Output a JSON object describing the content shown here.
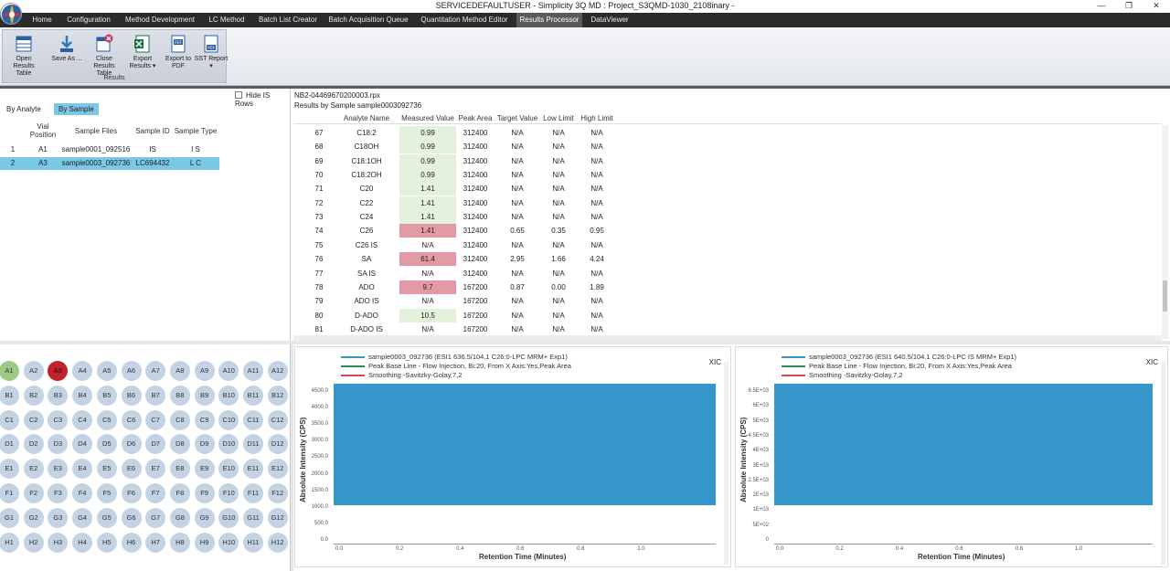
{
  "window": {
    "title": "SERVICEDEFAULTUSER - Simplicity 3Q MD : Project_S3QMD-1030_2108inary -",
    "minimize": "—",
    "restore": "❐",
    "close": "✕"
  },
  "menu": {
    "tabs": [
      "Home",
      "Configuration",
      "Method Development",
      "LC Method",
      "Batch List Creator",
      "Batch Acquisition Queue",
      "Quantitation Method Editor",
      "Results Processor",
      "DataViewer"
    ],
    "active_tab": "Results Processor"
  },
  "ribbon": {
    "group_label": "Results",
    "buttons": [
      {
        "label": "Open Results Table",
        "icon": "open-table-icon"
      },
      {
        "label": "Save As ...",
        "icon": "save-as-icon"
      },
      {
        "label": "Close Results Table",
        "icon": "close-table-icon"
      },
      {
        "label": "Export Results ▾",
        "icon": "excel-icon"
      },
      {
        "label": "Export to PDF",
        "icon": "pdf-icon"
      },
      {
        "label": "SST Report ▾",
        "icon": "sst-pdf-icon"
      }
    ]
  },
  "left_panel": {
    "tabs": [
      "By Analyte",
      "By Sample"
    ],
    "active_tab": "By Sample",
    "hide_is_label": "Hide IS Rows",
    "columns": [
      "Vial Position",
      "Sample Files",
      "Sample ID",
      "Sample Type"
    ],
    "rows": [
      {
        "n": "1",
        "vial": "A1",
        "file": "sample0001_092516",
        "id": "IS",
        "type": "I S"
      },
      {
        "n": "2",
        "vial": "A3",
        "file": "sample0003_092736",
        "id": "LC694432",
        "type": "L C"
      }
    ]
  },
  "results": {
    "file_name": "NB2-04469670200003.rpx",
    "caption": "Results by Sample sample0003092736",
    "columns": [
      "Analyte Name",
      "Measured Value",
      "Peak Area",
      "Target Value",
      "Low Limit",
      "High Limit"
    ],
    "rows": [
      {
        "n": "67",
        "analyte": "C18:2",
        "measured": "0.99",
        "status": "ok",
        "area": "312400",
        "target": "N/A",
        "low": "N/A",
        "high": "N/A"
      },
      {
        "n": "68",
        "analyte": "C18OH",
        "measured": "0.99",
        "status": "ok",
        "area": "312400",
        "target": "N/A",
        "low": "N/A",
        "high": "N/A"
      },
      {
        "n": "69",
        "analyte": "C18:1OH",
        "measured": "0.99",
        "status": "ok",
        "area": "312400",
        "target": "N/A",
        "low": "N/A",
        "high": "N/A"
      },
      {
        "n": "70",
        "analyte": "C18:2OH",
        "measured": "0.99",
        "status": "ok",
        "area": "312400",
        "target": "N/A",
        "low": "N/A",
        "high": "N/A"
      },
      {
        "n": "71",
        "analyte": "C20",
        "measured": "1.41",
        "status": "ok",
        "area": "312400",
        "target": "N/A",
        "low": "N/A",
        "high": "N/A"
      },
      {
        "n": "72",
        "analyte": "C22",
        "measured": "1.41",
        "status": "ok",
        "area": "312400",
        "target": "N/A",
        "low": "N/A",
        "high": "N/A"
      },
      {
        "n": "73",
        "analyte": "C24",
        "measured": "1.41",
        "status": "ok",
        "area": "312400",
        "target": "N/A",
        "low": "N/A",
        "high": "N/A"
      },
      {
        "n": "74",
        "analyte": "C26",
        "measured": "1.41",
        "status": "bad",
        "area": "312400",
        "target": "0.65",
        "low": "0.35",
        "high": "0.95"
      },
      {
        "n": "75",
        "analyte": "C26 IS",
        "measured": "N/A",
        "status": "none",
        "area": "312400",
        "target": "N/A",
        "low": "N/A",
        "high": "N/A"
      },
      {
        "n": "76",
        "analyte": "SA",
        "measured": "61.4",
        "status": "bad",
        "area": "312400",
        "target": "2.95",
        "low": "1.66",
        "high": "4.24"
      },
      {
        "n": "77",
        "analyte": "SA IS",
        "measured": "N/A",
        "status": "none",
        "area": "312400",
        "target": "N/A",
        "low": "N/A",
        "high": "N/A"
      },
      {
        "n": "78",
        "analyte": "ADO",
        "measured": "9.7",
        "status": "bad",
        "area": "167200",
        "target": "0.87",
        "low": "0.00",
        "high": "1.89"
      },
      {
        "n": "79",
        "analyte": "ADO IS",
        "measured": "N/A",
        "status": "none",
        "area": "167200",
        "target": "N/A",
        "low": "N/A",
        "high": "N/A"
      },
      {
        "n": "80",
        "analyte": "D-ADO",
        "measured": "10.5",
        "status": "ok",
        "area": "167200",
        "target": "N/A",
        "low": "N/A",
        "high": "N/A"
      },
      {
        "n": "81",
        "analyte": "D-ADO IS",
        "measured": "N/A",
        "status": "none",
        "area": "167200",
        "target": "N/A",
        "low": "N/A",
        "high": "N/A"
      }
    ]
  },
  "plate": {
    "rows": [
      "A",
      "B",
      "C",
      "D",
      "E",
      "F",
      "G",
      "H"
    ],
    "cols": 12,
    "completed": [
      "A1"
    ],
    "current": "A3"
  },
  "charts": [
    {
      "legend": [
        "sample0003_092736 (ESI1 636.5/104.1 C26:0-LPC MRM+ Exp1)",
        "Peak Base Line - Flow Injection, Bi:20, From X Axis:Yes,Peak Area",
        "Smoothing -Savitzky-Golay,7,2"
      ],
      "tag": "XIC",
      "ylabel": "Absolute Intensity (CPS)",
      "xlabel": "Retention Time (Minutes)",
      "yticks": [
        "4500.0",
        "4000.0",
        "3500.0",
        "3000.0",
        "2500.0",
        "2000.0",
        "1500.0",
        "1000.0",
        "500.0",
        "0.0"
      ],
      "xticks": [
        "0.0",
        "0.2",
        "0.4",
        "0.6",
        "0.8",
        "1.0"
      ]
    },
    {
      "legend": [
        "sample0003_092736 (ESI1 640.5/104.1 C26:0-LPC IS MRM+ Exp1)",
        "Peak Base Line - Flow Injection, Bi:20, From X Axis:Yes,Peak Area",
        "Smoothing -Savitzky-Golay,7,2"
      ],
      "tag": "XIC",
      "ylabel": "Absolute Intensity (CPS)",
      "xlabel": "Retention Time (Minutes)",
      "yticks": [
        "6.5E+03",
        "6E+03",
        "5E+03",
        "4.5E+03",
        "4E+03",
        "3E+03",
        "2.5E+03",
        "2E+03",
        "1E+03",
        "5E+02",
        "0"
      ],
      "xticks": [
        "0.0",
        "0.2",
        "0.4",
        "0.6",
        "0.8",
        "1.0"
      ]
    }
  ],
  "colors": {
    "series": "#3796c9",
    "baseline": "#2e8b57",
    "smoothing": "#d04a5a",
    "ok": "#e3f1dd",
    "bad": "#e39aa6",
    "selection": "#7ac7e6"
  }
}
